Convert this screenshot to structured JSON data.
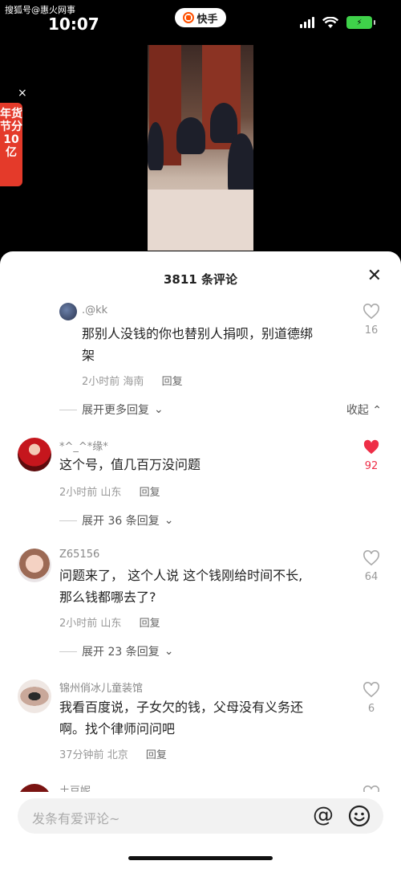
{
  "status_bar": {
    "watermark": "搜狐号@惠火网事",
    "time": "10:07",
    "app_name": "快手",
    "battery_icon": "charging-battery-icon"
  },
  "promo": {
    "text": "年货节分10亿"
  },
  "sheet": {
    "title": "3811 条评论",
    "close_icon": "close-icon"
  },
  "comments": [
    {
      "username": ".@kk",
      "text_line1": "那别人没钱的你也替别人捐呗，别道德绑",
      "text_line2": "架",
      "time": "2小时前",
      "location": "海南",
      "reply": "回复",
      "likes": "16",
      "liked": false,
      "expand": "展开更多回复",
      "collapse": "收起"
    },
    {
      "username": "*^_^*缘*",
      "text_line1": "这个号，值几百万没问题",
      "time": "2小时前",
      "location": "山东",
      "reply": "回复",
      "likes": "92",
      "liked": true,
      "expand": "展开 36 条回复"
    },
    {
      "username": "Z65156",
      "text_line1": "问题来了， 这个人说 这个钱刚给时间不长,",
      "text_line2": "那么钱都哪去了?",
      "time": "2小时前",
      "location": "山东",
      "reply": "回复",
      "likes": "64",
      "liked": false,
      "expand": "展开 23 条回复"
    },
    {
      "username": "锦州俏冰儿童装馆",
      "text_line1": "我看百度说，子女欠的钱，父母没有义务还",
      "text_line2": "啊。找个律师问问吧",
      "time": "37分钟前",
      "location": "北京",
      "reply": "回复",
      "likes": "6",
      "liked": false
    },
    {
      "username": "土豆妮"
    }
  ],
  "input": {
    "placeholder": "发条有爱评论~"
  },
  "colors": {
    "like_red": "#ee2e47",
    "brand": "#ff5000"
  }
}
